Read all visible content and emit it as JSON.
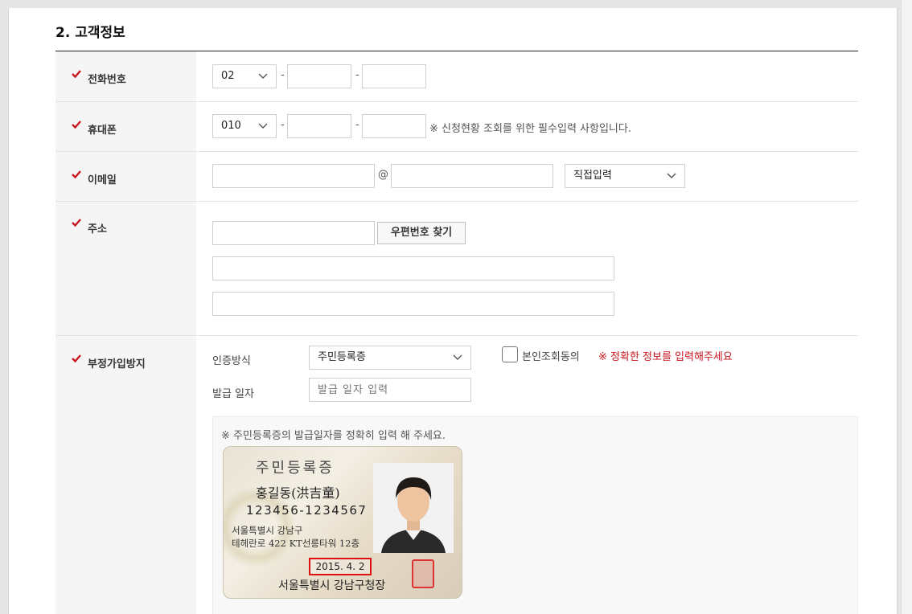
{
  "section": {
    "title": "2. 고객정보"
  },
  "phone": {
    "label": "전화번호",
    "area_code": "02",
    "dash": "-"
  },
  "mobile": {
    "label": "휴대폰",
    "prefix": "010",
    "dash": "-",
    "note": "※ 신청현황 조회를 위한 필수입력 사항입니다."
  },
  "email": {
    "label": "이메일",
    "at": "@",
    "domain_select": "직접입력"
  },
  "address": {
    "label": "주소",
    "zip_button": "우편번호 찾기"
  },
  "fraud": {
    "label": "부정가입방지",
    "auth_method_label": "인증방식",
    "auth_method_value": "주민등록증",
    "consent_label": "본인조회동의",
    "warning": "※ 정확한 정보를 입력해주세요",
    "issue_date_label": "발급 일자",
    "issue_date_placeholder": "발급 일자 입력",
    "guide_text": "※ 주민등록증의 발급일자를 정확히 입력 해 주세요."
  },
  "idcard": {
    "title": "주민등록증",
    "name": "홍길동(洪吉童)",
    "number": "123456-1234567",
    "address_line1": "서울특별시 강남구",
    "address_line2": "테헤란로 422 KT선릉타워 12층",
    "issue_date": "2015. 4. 2",
    "issuer": "서울특별시 강남구청장"
  },
  "colors": {
    "accent_red": "#c8161d",
    "label_bg": "#f5f5f5"
  }
}
